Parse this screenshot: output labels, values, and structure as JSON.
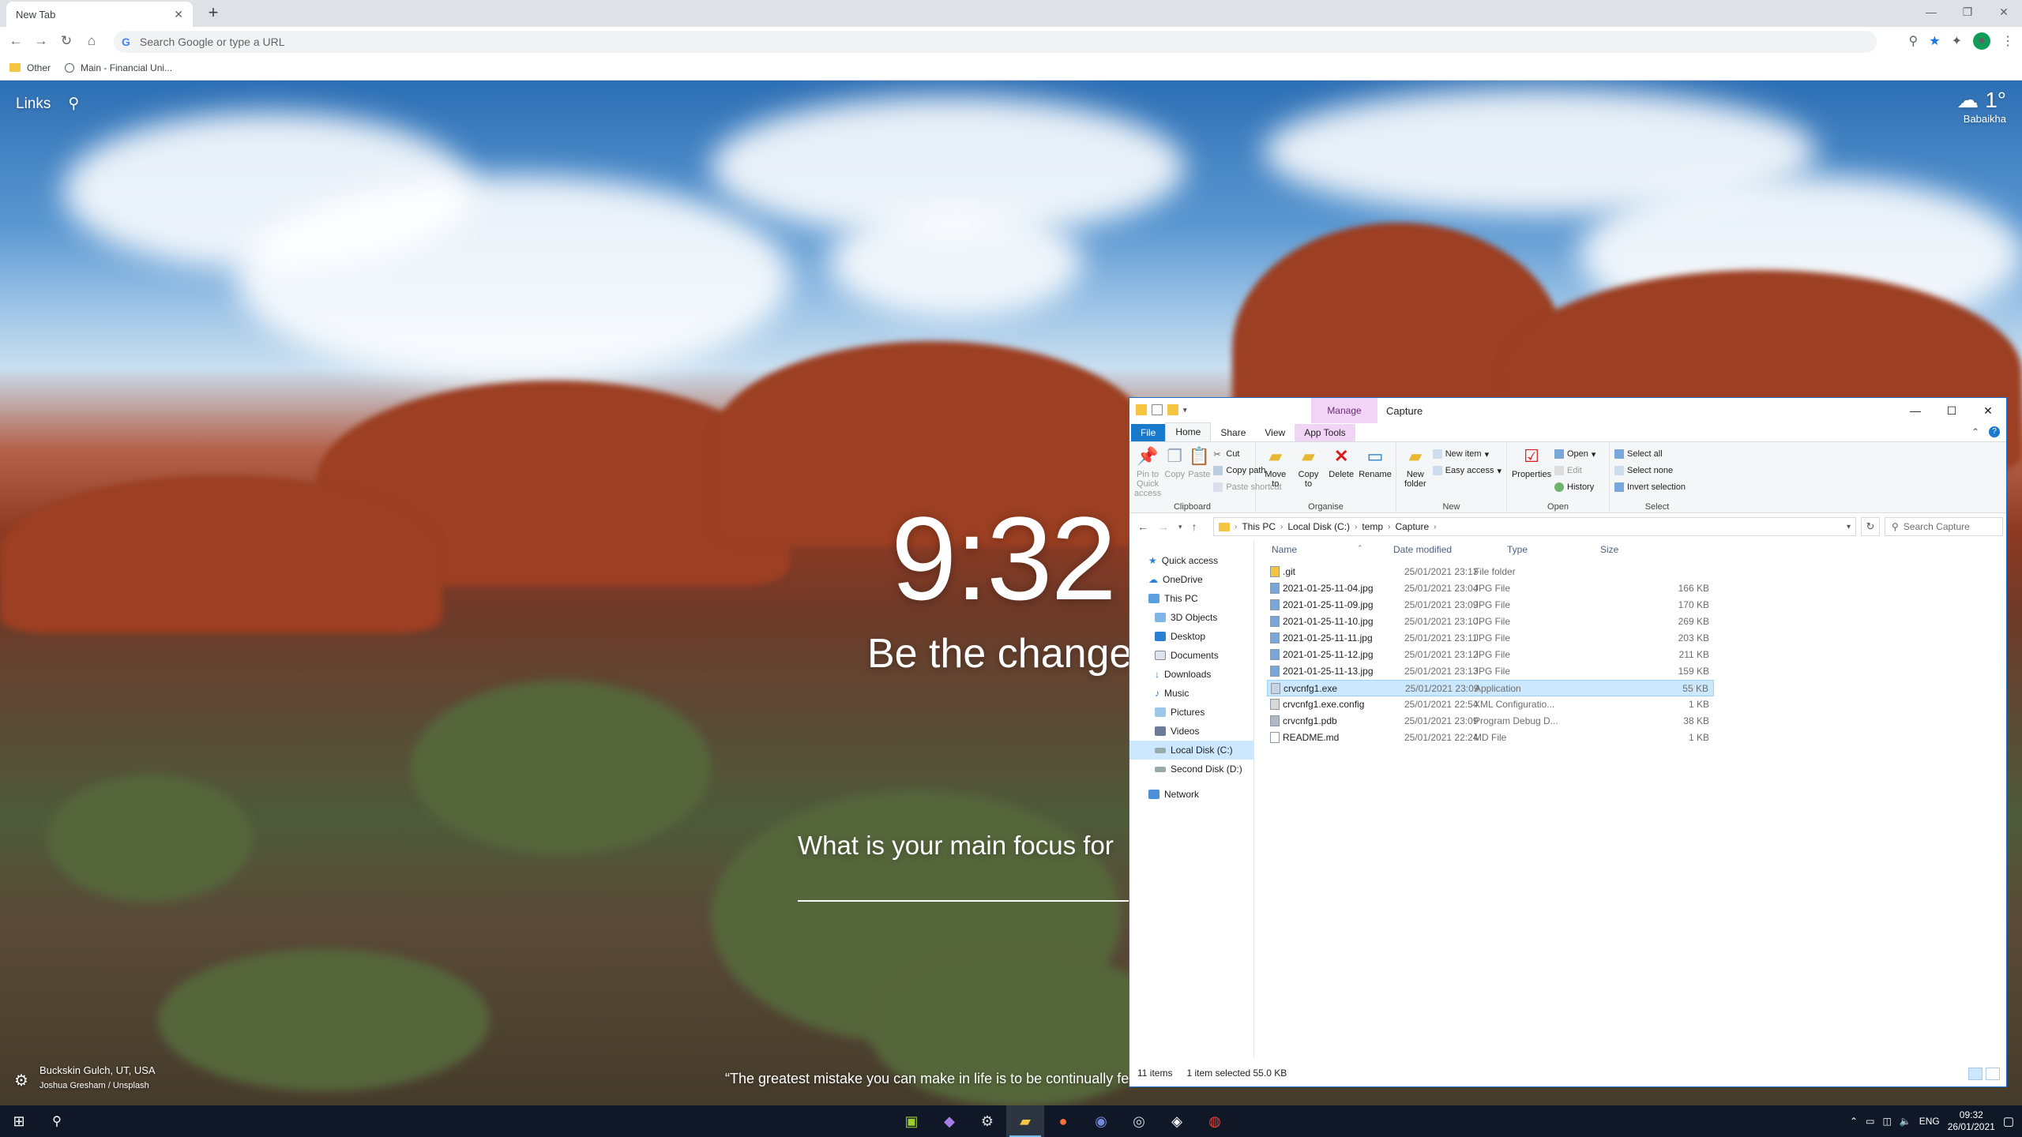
{
  "chrome": {
    "tab_title": "New Tab",
    "omnibox_placeholder": "Search Google or type a URL",
    "bookmarks": [
      {
        "label": "Other"
      },
      {
        "label": "Main - Financial Uni..."
      }
    ]
  },
  "momentum": {
    "links_label": "Links",
    "weather_temp": "1°",
    "weather_location": "Babaikha",
    "clock": "9:32",
    "mantra": "Be the change",
    "focus_question": "What is your main focus for",
    "photo_location": "Buckskin Gulch, UT, USA",
    "photo_credit": "Joshua Gresham / Unsplash",
    "quote": "“The greatest mistake you can make in life is to be continually fe"
  },
  "explorer": {
    "title": "Capture",
    "manage_tab": "Manage",
    "ribbon_tabs": [
      "File",
      "Home",
      "Share",
      "View",
      "App Tools"
    ],
    "clipboard": {
      "group": "Clipboard",
      "pin": "Pin to Quick access",
      "copy": "Copy",
      "paste": "Paste",
      "cut": "Cut",
      "copy_path": "Copy path",
      "paste_shortcut": "Paste shortcut"
    },
    "organise": {
      "group": "Organise",
      "move_to": "Move to",
      "copy_to": "Copy to",
      "delete": "Delete",
      "rename": "Rename"
    },
    "new": {
      "group": "New",
      "new_folder": "New folder",
      "new_item": "New item",
      "easy_access": "Easy access"
    },
    "open": {
      "group": "Open",
      "properties": "Properties",
      "open": "Open",
      "edit": "Edit",
      "history": "History"
    },
    "select": {
      "group": "Select",
      "select_all": "Select all",
      "select_none": "Select none",
      "invert": "Invert selection"
    },
    "path": [
      "This PC",
      "Local Disk (C:)",
      "temp",
      "Capture"
    ],
    "search_placeholder": "Search Capture",
    "nav": {
      "quick_access": "Quick access",
      "onedrive": "OneDrive",
      "this_pc": "This PC",
      "objects3d": "3D Objects",
      "desktop": "Desktop",
      "documents": "Documents",
      "downloads": "Downloads",
      "music": "Music",
      "pictures": "Pictures",
      "videos": "Videos",
      "local_disk": "Local Disk (C:)",
      "second_disk": "Second Disk (D:)",
      "network": "Network"
    },
    "columns": {
      "name": "Name",
      "date": "Date modified",
      "type": "Type",
      "size": "Size"
    },
    "files": [
      {
        "name": ".git",
        "date": "25/01/2021 23:13",
        "type": "File folder",
        "size": ""
      },
      {
        "name": "2021-01-25-11-04.jpg",
        "date": "25/01/2021 23:04",
        "type": "JPG File",
        "size": "166 KB"
      },
      {
        "name": "2021-01-25-11-09.jpg",
        "date": "25/01/2021 23:09",
        "type": "JPG File",
        "size": "170 KB"
      },
      {
        "name": "2021-01-25-11-10.jpg",
        "date": "25/01/2021 23:10",
        "type": "JPG File",
        "size": "269 KB"
      },
      {
        "name": "2021-01-25-11-11.jpg",
        "date": "25/01/2021 23:11",
        "type": "JPG File",
        "size": "203 KB"
      },
      {
        "name": "2021-01-25-11-12.jpg",
        "date": "25/01/2021 23:12",
        "type": "JPG File",
        "size": "211 KB"
      },
      {
        "name": "2021-01-25-11-13.jpg",
        "date": "25/01/2021 23:13",
        "type": "JPG File",
        "size": "159 KB"
      },
      {
        "name": "crvcnfg1.exe",
        "date": "25/01/2021 23:09",
        "type": "Application",
        "size": "55 KB"
      },
      {
        "name": "crvcnfg1.exe.config",
        "date": "25/01/2021 22:54",
        "type": "XML Configuratio...",
        "size": "1 KB"
      },
      {
        "name": "crvcnfg1.pdb",
        "date": "25/01/2021 23:09",
        "type": "Program Debug D...",
        "size": "38 KB"
      },
      {
        "name": "README.md",
        "date": "25/01/2021 22:24",
        "type": "MD File",
        "size": "1 KB"
      }
    ],
    "status_items": "11 items",
    "status_selected": "1 item selected  55.0 KB"
  },
  "taskbar": {
    "lang": "ENG",
    "time": "09:32",
    "date": "26/01/2021"
  }
}
